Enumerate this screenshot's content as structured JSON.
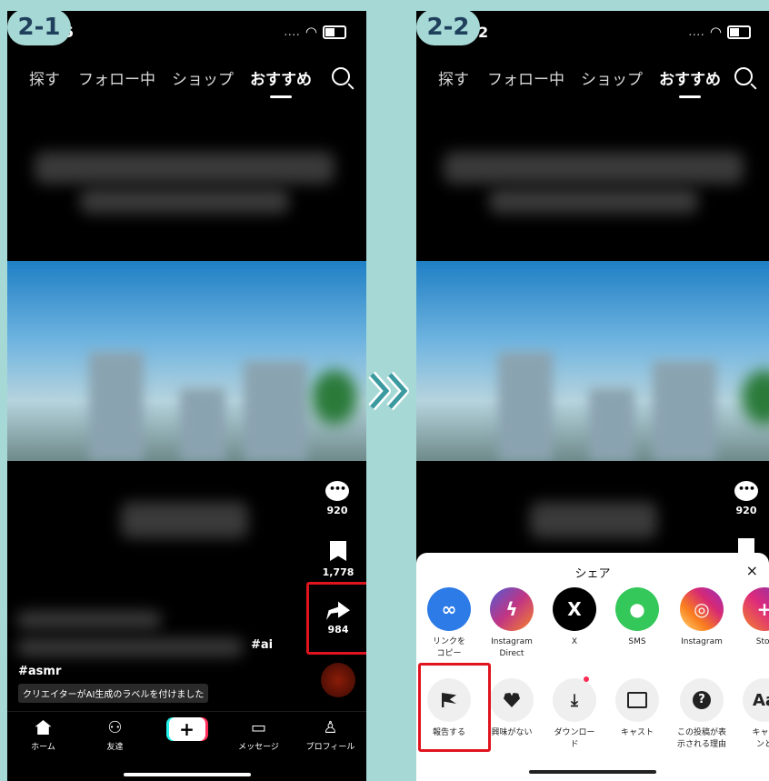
{
  "step1": {
    "badge": "2-1",
    "clock": "5",
    "nav_tabs": [
      "探す",
      "フォロー中",
      "ショップ",
      "おすすめ"
    ],
    "comment_count": "920",
    "bookmark_count": "1,778",
    "share_count": "984",
    "hashtag_ai": "#ai",
    "hashtag_asmr": "#asmr",
    "ai_label": "クリエイターがAI生成のラベルを付けました",
    "bottom_nav": [
      "ホーム",
      "友達",
      "+",
      "メッセージ",
      "プロフィール"
    ]
  },
  "step2": {
    "badge": "2-2",
    "clock": "2",
    "nav_tabs": [
      "探す",
      "フォロー中",
      "ショップ",
      "おすすめ"
    ],
    "comment_count": "920",
    "sheet_title": "シェア",
    "close": "×",
    "share_targets": [
      {
        "label": "リンクを\nコピー",
        "icon": "link-icon",
        "color": "#2d7be6"
      },
      {
        "label": "Instagram\nDirect",
        "icon": "messenger-icon",
        "color": "#c13584"
      },
      {
        "label": "X",
        "icon": "x-icon",
        "color": "#000000"
      },
      {
        "label": "SMS",
        "icon": "sms-icon",
        "color": "#34c759"
      },
      {
        "label": "Instagram",
        "icon": "instagram-icon",
        "color": "#dd2a7b"
      },
      {
        "label": "Stor",
        "icon": "stories-icon",
        "color": "#e1306c"
      }
    ],
    "actions": [
      {
        "label": "報告する",
        "icon": "flag-icon"
      },
      {
        "label": "興味がない",
        "icon": "broken-heart-icon"
      },
      {
        "label": "ダウンロー\nド",
        "icon": "download-icon"
      },
      {
        "label": "キャスト",
        "icon": "cast-icon"
      },
      {
        "label": "この投稿が表\n示される理由",
        "icon": "question-icon"
      },
      {
        "label": "キャプ\nンと",
        "icon": "text-icon",
        "glyph": "Aa"
      }
    ]
  },
  "colors": {
    "background": "#a6d9d6",
    "highlight": "#e0141f",
    "badge_text": "#1f3f5c"
  }
}
